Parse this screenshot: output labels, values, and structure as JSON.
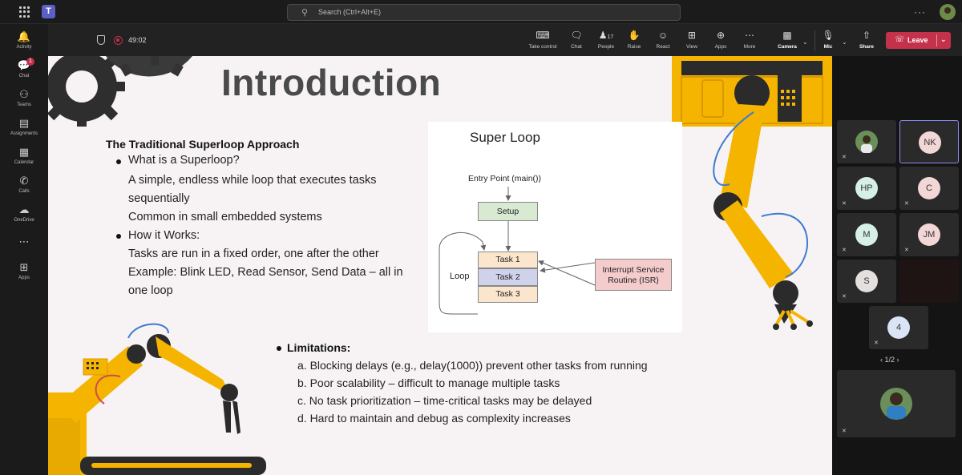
{
  "topbar": {
    "search_placeholder": "Search (Ctrl+Alt+E)",
    "search_icon": "search-icon",
    "more": "···"
  },
  "rail": {
    "items": [
      {
        "label": "Activity",
        "icon": "bell-icon"
      },
      {
        "label": "Chat",
        "icon": "chat-icon",
        "badge": "1"
      },
      {
        "label": "Teams",
        "icon": "teams-icon"
      },
      {
        "label": "Assignments",
        "icon": "assignments-icon"
      },
      {
        "label": "Calendar",
        "icon": "calendar-icon"
      },
      {
        "label": "Calls",
        "icon": "phone-icon"
      },
      {
        "label": "OneDrive",
        "icon": "cloud-icon"
      },
      {
        "label": "",
        "icon": "more-icon"
      },
      {
        "label": "Apps",
        "icon": "apps-icon"
      }
    ]
  },
  "meeting": {
    "timer": "49:02",
    "people_count": "17",
    "buttons": {
      "take_control": "Take control",
      "chat": "Chat",
      "people": "People",
      "raise": "Raise",
      "react": "React",
      "view": "View",
      "apps": "Apps",
      "more": "More",
      "camera": "Camera",
      "mic": "Mic",
      "share": "Share",
      "leave": "Leave"
    }
  },
  "slide": {
    "title": "Introduction",
    "section_heading": "The Traditional Superloop Approach",
    "q1": "What is a Superloop?",
    "q1_lines": [
      "A simple, endless while loop that executes tasks",
      "sequentially",
      "Common in small embedded systems"
    ],
    "q2": "How it Works:",
    "q2_lines": [
      "Tasks are run in a fixed order, one after the other",
      "Example: Blink LED, Read Sensor, Send Data – all in",
      "one loop"
    ],
    "diagram": {
      "title": "Super Loop",
      "entry": "Entry Point (main())",
      "setup": "Setup",
      "tasks": [
        "Task 1",
        "Task 2",
        "Task 3"
      ],
      "loop": "Loop",
      "isr_line1": "Interrupt Service",
      "isr_line2": "Routine (ISR)"
    },
    "limitations_title": "Limitations:",
    "limitations": [
      "a. Blocking delays (e.g., delay(1000)) prevent other tasks from running",
      "b. Poor scalability – difficult to manage multiple tasks",
      "c. No task prioritization – time-critical tasks may be delayed",
      "d. Hard to maintain and debug as complexity increases"
    ]
  },
  "participants": {
    "tiles": [
      {
        "initials": "",
        "color": "#6b8f5a"
      },
      {
        "initials": "NK",
        "color": "#f3d6d6"
      },
      {
        "initials": "HP",
        "color": "#d6efe7"
      },
      {
        "initials": "C",
        "color": "#f3d6d6"
      },
      {
        "initials": "M",
        "color": "#d6efe7"
      },
      {
        "initials": "JM",
        "color": "#f3d6d6"
      },
      {
        "initials": "S",
        "color": "#e4e0de"
      },
      {
        "initials": "",
        "color": ""
      },
      {
        "initials": "4",
        "color": "#dbe4f5"
      }
    ],
    "pager": "1/2"
  }
}
